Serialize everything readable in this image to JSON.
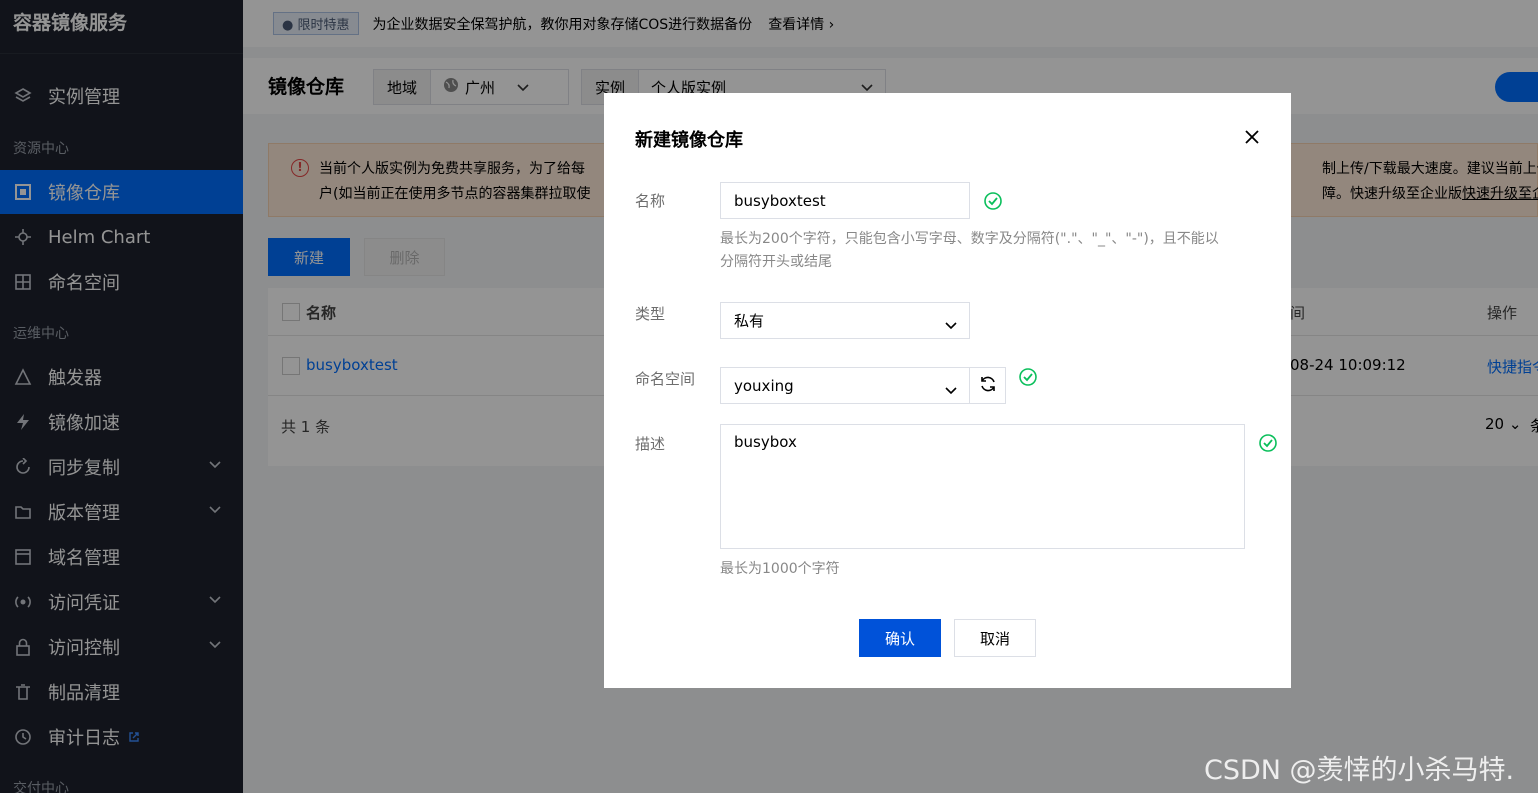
{
  "sidebar": {
    "title": "容器镜像服务",
    "groups": [
      "资源中心",
      "运维中心",
      "交付中心"
    ],
    "items": [
      {
        "label": "实例管理",
        "icon": "layers-icon"
      },
      {
        "label": "镜像仓库",
        "icon": "repository-icon",
        "active": true
      },
      {
        "label": "Helm Chart",
        "icon": "helm-icon"
      },
      {
        "label": "命名空间",
        "icon": "namespace-icon"
      },
      {
        "label": "触发器",
        "icon": "trigger-icon"
      },
      {
        "label": "镜像加速",
        "icon": "lightning-icon"
      },
      {
        "label": "同步复制",
        "icon": "sync-icon",
        "expandable": true
      },
      {
        "label": "版本管理",
        "icon": "folder-icon",
        "expandable": true
      },
      {
        "label": "域名管理",
        "icon": "domain-icon"
      },
      {
        "label": "访问凭证",
        "icon": "credential-icon",
        "expandable": true
      },
      {
        "label": "访问控制",
        "icon": "lock-icon",
        "expandable": true
      },
      {
        "label": "制品清理",
        "icon": "trash-icon"
      },
      {
        "label": "审计日志",
        "icon": "history-icon",
        "external": true
      }
    ]
  },
  "banner": {
    "tag": "限时特惠",
    "text": "为企业数据安全保驾护航，教你用对象存储COS进行数据备份",
    "more": "查看详情"
  },
  "header": {
    "title": "镜像仓库",
    "region_label": "地域",
    "region_value": "广州",
    "instance_label": "实例",
    "instance_value": "个人版实例"
  },
  "alert": {
    "line1_left": "当前个人版实例为免费共享服务，为了给每",
    "line1_right": "制上传/下载最大速度。建议当前上传/",
    "line2_left": "户(如当前正在使用多节点的容器集群拉取使",
    "line2_right_a": "障。快速升级至企业版",
    "line2_right_b": "快速升级至企"
  },
  "toolbar": {
    "new_label": "新建",
    "delete_label": "删除"
  },
  "table": {
    "col_name": "名称",
    "col_time": "间",
    "col_action": "操作",
    "rows": [
      {
        "name": "busyboxtest",
        "time": "08-24 10:09:12",
        "action": "快捷指令"
      }
    ],
    "total": "共 1 条",
    "page_size": "20",
    "page_unit": "条"
  },
  "modal": {
    "title": "新建镜像仓库",
    "name_label": "名称",
    "name_value": "busyboxtest",
    "name_hint_1": "最长为200个字符，只能包含小写字母、数字及分隔符(\".\"、\"_\"、\"-\")，且不能以",
    "name_hint_2": "分隔符开头或结尾",
    "type_label": "类型",
    "type_value": "私有",
    "namespace_label": "命名空间",
    "namespace_value": "youxing",
    "desc_label": "描述",
    "desc_value": "busybox",
    "desc_hint": "最长为1000个字符",
    "confirm_label": "确认",
    "cancel_label": "取消"
  },
  "watermark": "CSDN @羡悻的小杀马特."
}
